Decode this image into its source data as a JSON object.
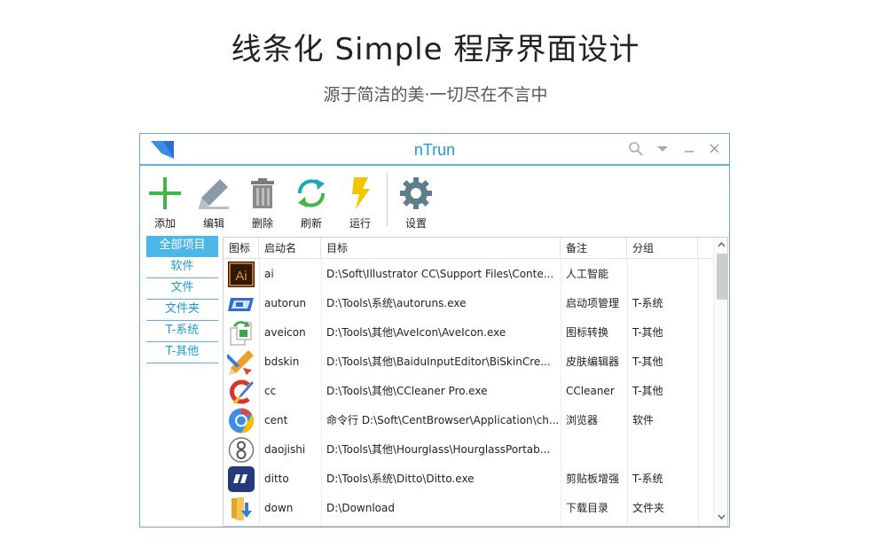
{
  "page": {
    "title": "线条化 Simple 程序界面设计",
    "subtitle": "源于简洁的美·一切尽在不言中"
  },
  "window": {
    "title": "nTrun",
    "controls": [
      "search-icon",
      "dropdown-icon",
      "minimize-icon",
      "close-icon"
    ]
  },
  "toolbar": {
    "add": "添加",
    "edit": "编辑",
    "delete": "删除",
    "refresh": "刷新",
    "run": "运行",
    "settings": "设置"
  },
  "colors": {
    "accent": "#1e9bd7",
    "sidebar_active": "#4db6e8",
    "add_green": "#43b649",
    "run_yellow": "#f5c400"
  },
  "sidebar": {
    "items": [
      {
        "label": "全部项目",
        "active": true
      },
      {
        "label": "软件",
        "active": false
      },
      {
        "label": "文件",
        "active": false
      },
      {
        "label": "文件夹",
        "active": false
      },
      {
        "label": "T-系统",
        "active": false
      },
      {
        "label": "T-其他",
        "active": false
      }
    ]
  },
  "table": {
    "headers": [
      "图标",
      "启动名",
      "目标",
      "备注",
      "分组"
    ],
    "rows": [
      {
        "icon": "illustrator-icon",
        "name": "ai",
        "target": "D:\\Soft\\Illustrator CC\\Support Files\\Conte...",
        "note": "人工智能",
        "group": ""
      },
      {
        "icon": "autoruns-icon",
        "name": "autorun",
        "target": "D:\\Tools\\系统\\autoruns.exe",
        "note": "启动项管理",
        "group": "T-系统"
      },
      {
        "icon": "aveicon-icon",
        "name": "aveicon",
        "target": "D:\\Tools\\其他\\AveIcon\\AveIcon.exe",
        "note": "图标转换",
        "group": "T-其他"
      },
      {
        "icon": "pencil-icon",
        "name": "bdskin",
        "target": "D:\\Tools\\其他\\BaiduInputEditor\\BiSkinCre...",
        "note": "皮肤编辑器",
        "group": "T-其他"
      },
      {
        "icon": "ccleaner-icon",
        "name": "cc",
        "target": "D:\\Tools\\其他\\CCleaner Pro.exe",
        "note": "CCleaner",
        "group": "T-其他"
      },
      {
        "icon": "centbrowser-icon",
        "name": "cent",
        "target": "命令行 D:\\Soft\\CentBrowser\\Application\\ch...",
        "note": "浏览器",
        "group": "软件"
      },
      {
        "icon": "hourglass-icon",
        "name": "daojishi",
        "target": "D:\\Tools\\其他\\Hourglass\\HourglassPortab...",
        "note": "",
        "group": ""
      },
      {
        "icon": "ditto-icon",
        "name": "ditto",
        "target": "D:\\Tools\\系统\\Ditto\\Ditto.exe",
        "note": "剪贴板增强",
        "group": "T-系统"
      },
      {
        "icon": "download-folder-icon",
        "name": "down",
        "target": "D:\\Download",
        "note": "下载目录",
        "group": "文件夹"
      }
    ]
  }
}
